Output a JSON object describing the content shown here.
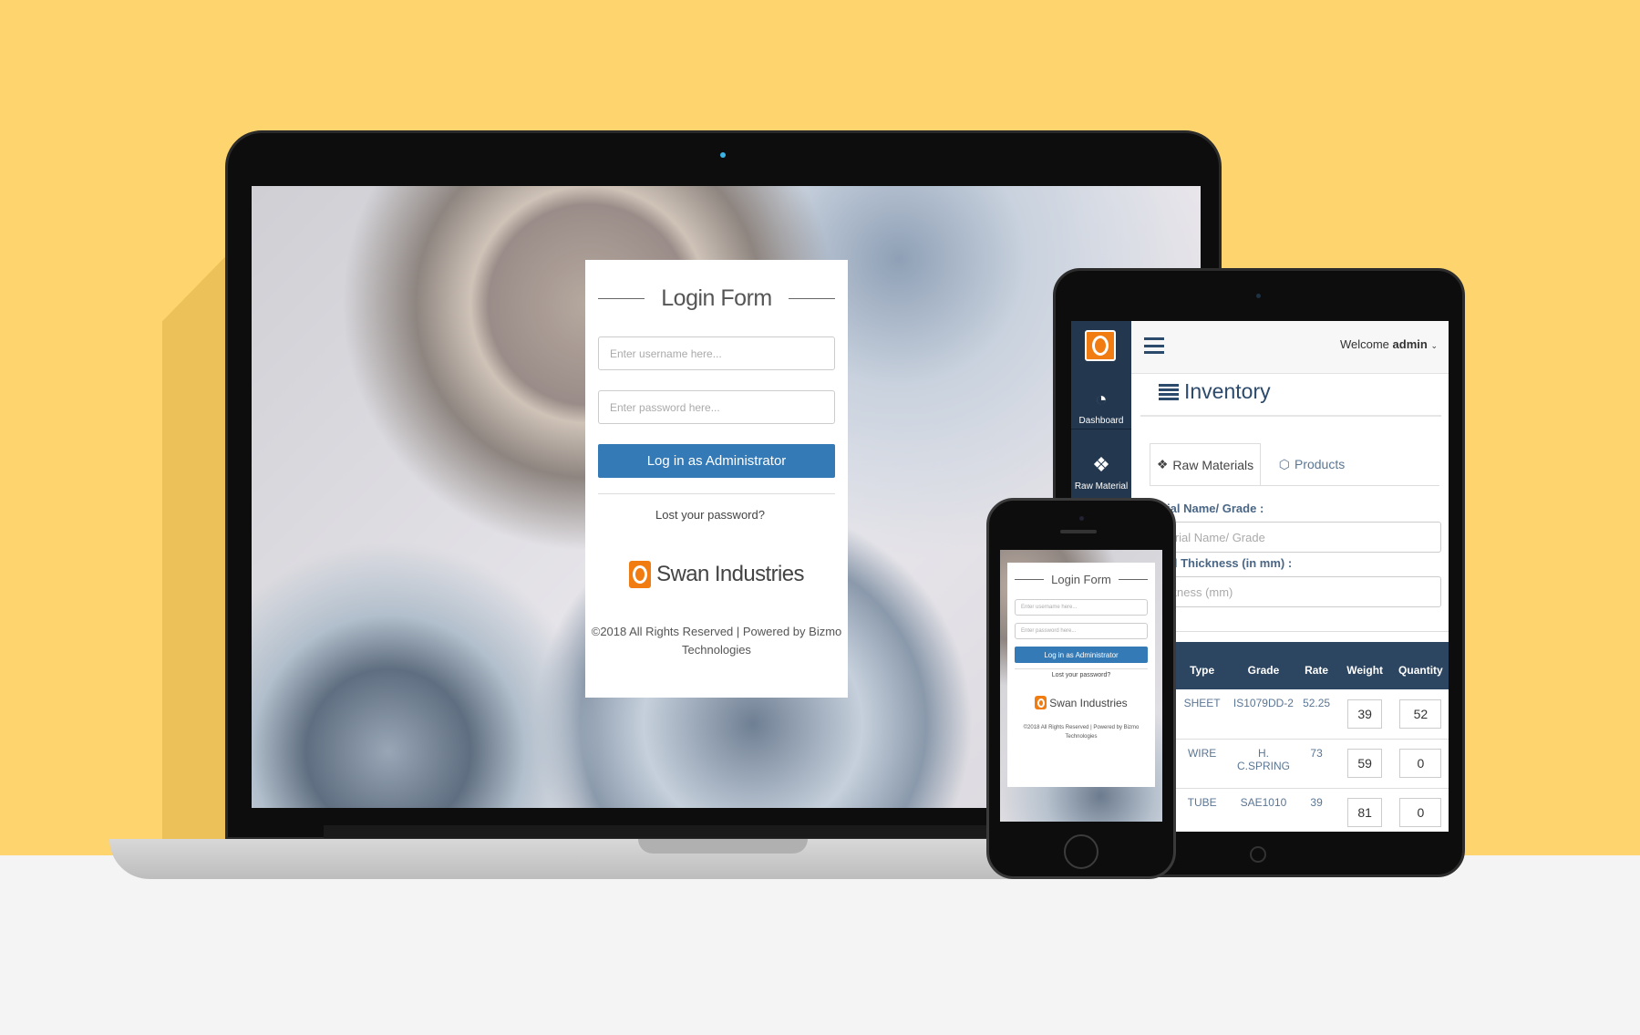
{
  "login": {
    "title": "Login Form",
    "username_placeholder": "Enter username here...",
    "password_placeholder": "Enter password here...",
    "login_button": "Log in as Administrator",
    "lost_password": "Lost your password?",
    "brand": "Swan Industries",
    "footer_line1": "©2018 All Rights Reserved | Powered by Bizmo",
    "footer_line2": "Technologies"
  },
  "tablet": {
    "sidebar": [
      {
        "label": "Dashboard",
        "icon": "dashboard-icon"
      },
      {
        "label": "Raw Material",
        "icon": "cubes-icon"
      }
    ],
    "welcome_text": "Welcome",
    "user": "admin",
    "page_title": "Inventory",
    "tabs": [
      {
        "label": "Raw Materials",
        "active": true
      },
      {
        "label": "Products",
        "active": false
      }
    ],
    "field1_label": "rial Name/ Grade :",
    "field1_placeholder": "terial Name/ Grade",
    "field2_label": "ial Thickness (in mm) :",
    "field2_placeholder": "ckness (mm)",
    "table": {
      "headers": [
        "Type",
        "Grade",
        "Rate",
        "Weight",
        "Quantity"
      ],
      "rows": [
        {
          "type": "SHEET",
          "grade": "IS1079DD-2",
          "rate": "52.25",
          "weight": "39",
          "quantity": "52"
        },
        {
          "type": "WIRE",
          "grade": "H. C.SPRING",
          "rate": "73",
          "weight": "59",
          "quantity": "0"
        },
        {
          "type": "TUBE",
          "grade": "SAE1010",
          "rate": "39",
          "weight": "81",
          "quantity": "0"
        }
      ]
    }
  },
  "colors": {
    "background": "#fed46e",
    "primary_button": "#337ab7",
    "sidebar": "#23384f",
    "brand_orange": "#f07c12",
    "table_header": "#2c4560"
  }
}
